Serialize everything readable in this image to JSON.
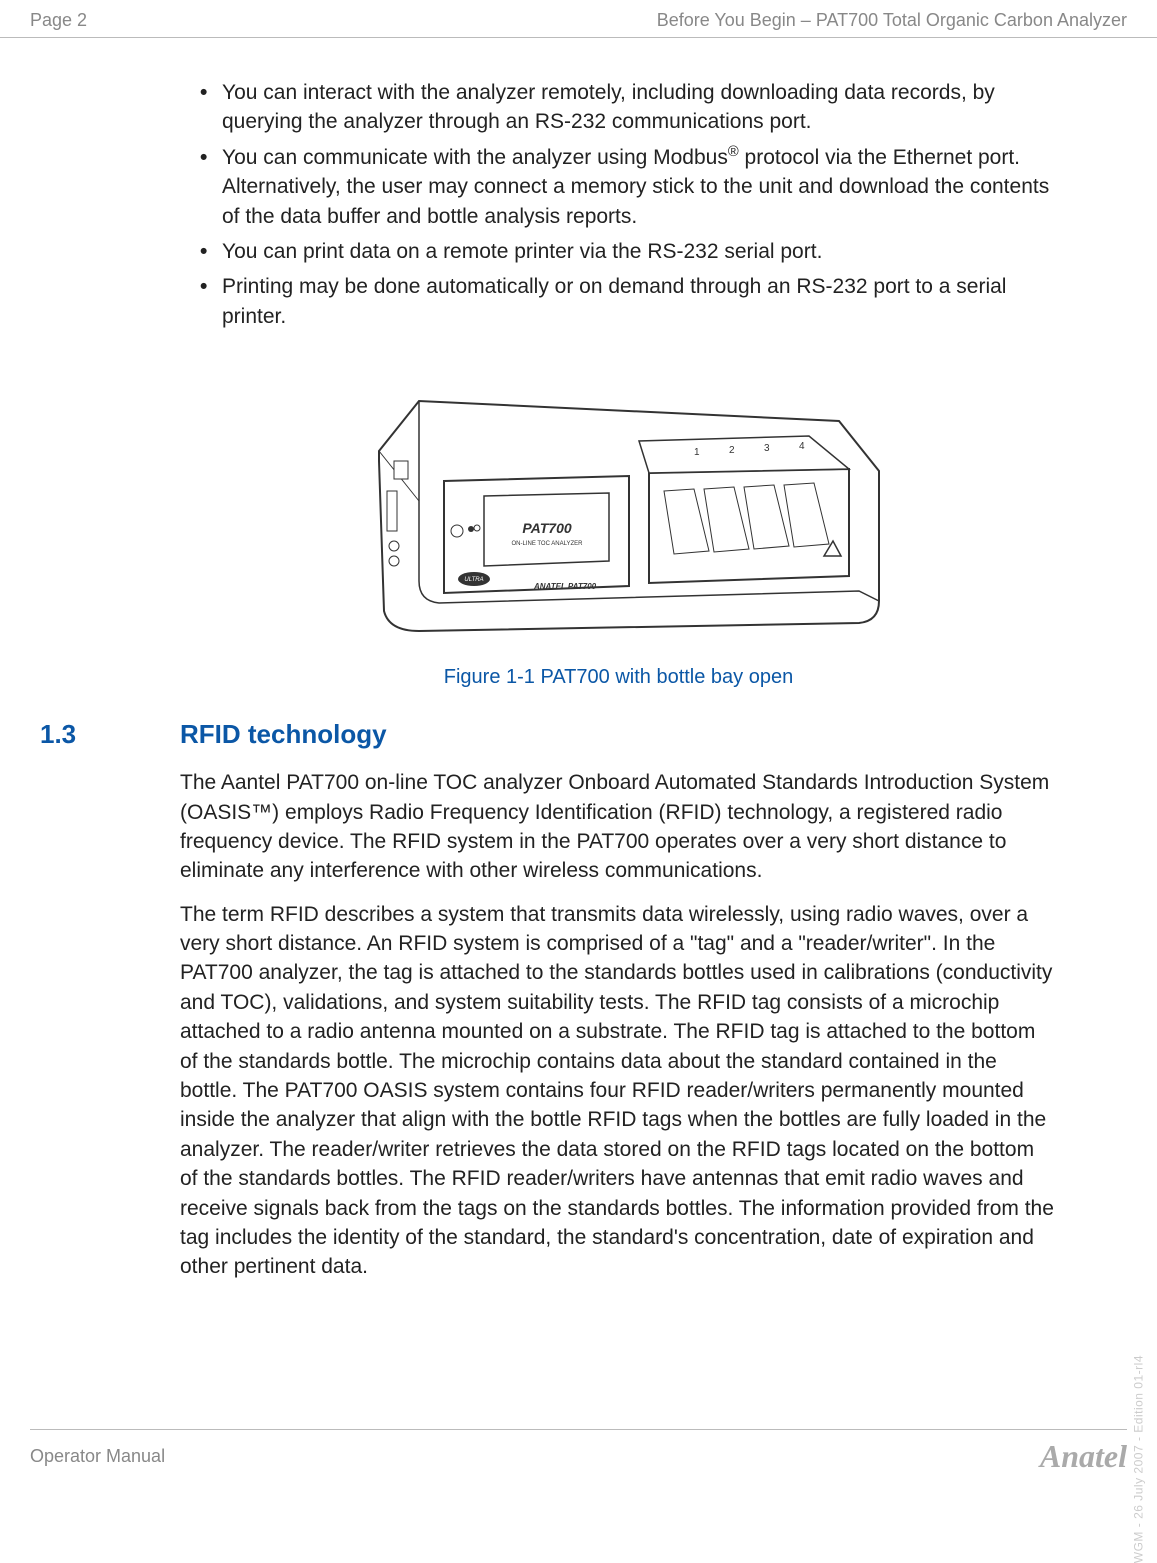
{
  "header": {
    "page_label": "Page 2",
    "doc_title": "Before You Begin – PAT700 Total Organic Carbon Analyzer"
  },
  "bullets": [
    "You can interact with the analyzer remotely, including downloading data records, by querying the analyzer through an RS-232 communications port.",
    "You can communicate with the analyzer using Modbus® protocol via the Ethernet port. Alternatively, the user may connect a memory stick to the unit and download the contents of the data buffer and bottle analysis reports.",
    "You can print data on a remote printer via the RS-232 serial port.",
    "Printing may be done automatically or on demand through an RS-232 port to a serial printer."
  ],
  "figure": {
    "device_labels": {
      "brand": "ANATEL PAT700",
      "model": "PAT700",
      "subtitle": "ON-LINE TOC ANALYZER",
      "logo": "ULTRA",
      "slots": [
        "1",
        "2",
        "3",
        "4"
      ]
    },
    "caption": "Figure 1-1 PAT700 with bottle bay open"
  },
  "section": {
    "number": "1.3",
    "title": "RFID technology",
    "para1": "The Aantel PAT700 on-line TOC analyzer Onboard Automated Standards Introduction System (OASIS™) employs Radio Frequency Identification (RFID) technology, a registered radio frequency device. The RFID system in the PAT700 operates over a very short distance to eliminate any interference with other wireless communications.",
    "para2": "The term RFID describes a system that transmits data wirelessly, using radio waves, over a very short distance. An RFID system is comprised of a \"tag\" and a \"reader/writer\". In the PAT700 analyzer, the tag is attached to the standards bottles used in calibrations (conductivity and TOC), validations, and system suitability tests. The RFID tag consists of a microchip attached to a radio antenna mounted on a substrate. The RFID tag is attached to the bottom of the standards bottle. The microchip contains data about the standard contained in the bottle. The PAT700 OASIS system contains four RFID reader/writers permanently mounted inside the analyzer that align with the bottle RFID tags when the bottles are fully loaded in the analyzer. The reader/writer retrieves the data stored on the RFID tags located on the bottom of the standards bottles. The RFID reader/writers have antennas that emit radio waves and receive signals back from the tags on the standards bottles. The information provided from the tag includes the identity of the standard, the standard's concentration, date of expiration and other pertinent data."
  },
  "footer": {
    "left": "Operator Manual",
    "right": "Anatel"
  },
  "side_text": "WGM - 26 July 2007 - Edition 01-rl4"
}
